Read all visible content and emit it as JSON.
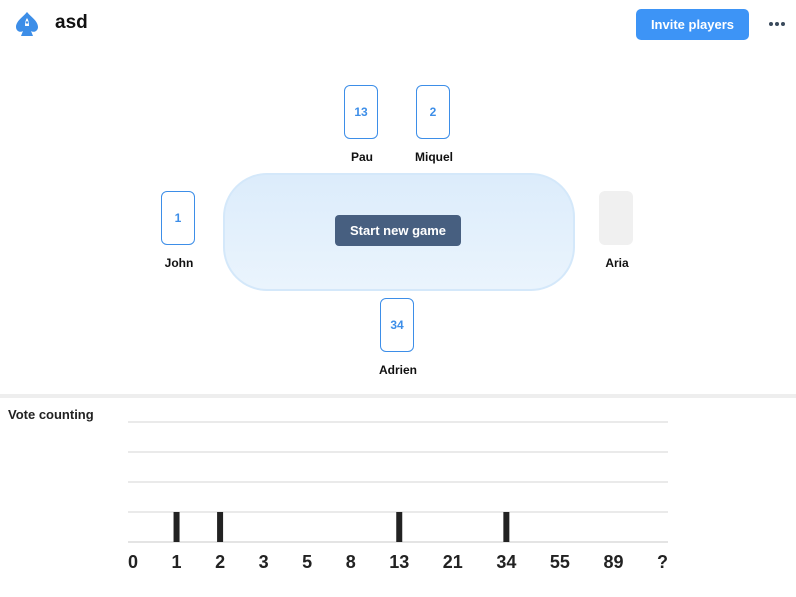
{
  "header": {
    "title": "asd",
    "logo_icon": "spade-rocket-icon",
    "invite_label": "Invite players",
    "more_icon": "more-horizontal-icon"
  },
  "table": {
    "start_label": "Start new game"
  },
  "players": [
    {
      "name": "Pau",
      "card": "13"
    },
    {
      "name": "Miquel",
      "card": "2"
    },
    {
      "name": "John",
      "card": "1"
    },
    {
      "name": "Aria",
      "card": ""
    },
    {
      "name": "Adrien",
      "card": "34"
    }
  ],
  "colors": {
    "accent": "#3d94f6",
    "start_button": "#475f80",
    "bar": "#222222"
  },
  "chart_data": {
    "type": "bar",
    "title": "Vote counting",
    "categories": [
      "0",
      "1",
      "2",
      "3",
      "5",
      "8",
      "13",
      "21",
      "34",
      "55",
      "89",
      "?"
    ],
    "values": [
      0,
      1,
      1,
      0,
      0,
      0,
      1,
      0,
      1,
      0,
      0,
      0
    ],
    "ylim": [
      0,
      4
    ],
    "grid": true
  }
}
